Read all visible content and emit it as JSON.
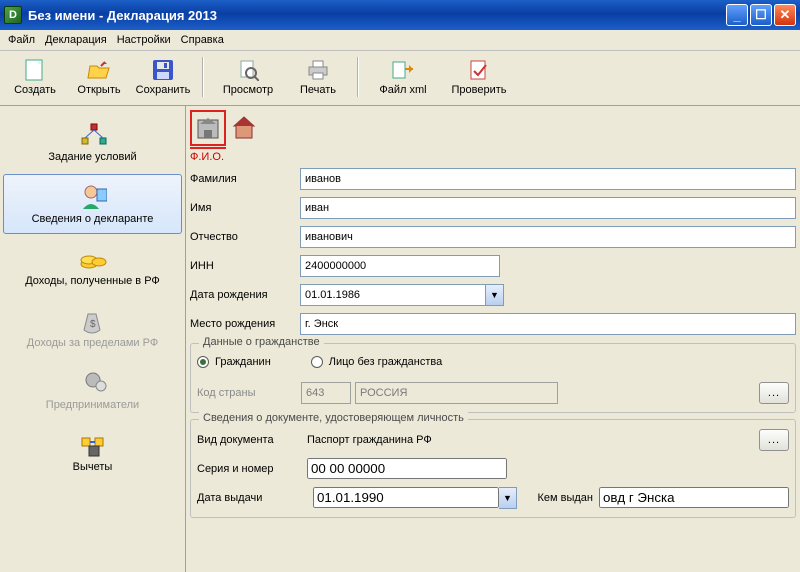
{
  "title": "Без имени - Декларация 2013",
  "menus": [
    "Файл",
    "Декларация",
    "Настройки",
    "Справка"
  ],
  "toolbar": {
    "create": "Создать",
    "open": "Открыть",
    "save": "Сохранить",
    "preview": "Просмотр",
    "print": "Печать",
    "filexml": "Файл xml",
    "check": "Проверить"
  },
  "sidebar": {
    "conditions": "Задание условий",
    "declarant": "Сведения о декларанте",
    "income_rf": "Доходы, полученные в РФ",
    "income_abroad": "Доходы за пределами РФ",
    "entrepreneur": "Предприниматели",
    "deductions": "Вычеты"
  },
  "fio": {
    "section": "Ф.И.О.",
    "surname_label": "Фамилия",
    "surname": "иванов",
    "name_label": "Имя",
    "name": "иван",
    "patronymic_label": "Отчество",
    "patronymic": "иванович",
    "inn_label": "ИНН",
    "inn": "2400000000",
    "birthdate_label": "Дата рождения",
    "birthdate": "01.01.1986",
    "birthplace_label": "Место рождения",
    "birthplace": "г. Энск"
  },
  "citizenship": {
    "legend": "Данные о гражданстве",
    "citizen": "Гражданин",
    "stateless": "Лицо без гражданства",
    "country_label": "Код страны",
    "country_code": "643",
    "country_name": "РОССИЯ",
    "browse": "..."
  },
  "document": {
    "legend": "Сведения о документе, удостоверяющем личность",
    "doctype_label": "Вид документа",
    "doctype": "Паспорт гражданина РФ",
    "serial_label": "Серия и номер",
    "serial": "00 00 00000",
    "issuedate_label": "Дата выдачи",
    "issuedate": "01.01.1990",
    "issuedby_label": "Кем выдан",
    "issuedby": "овд г Энска",
    "browse": "..."
  }
}
